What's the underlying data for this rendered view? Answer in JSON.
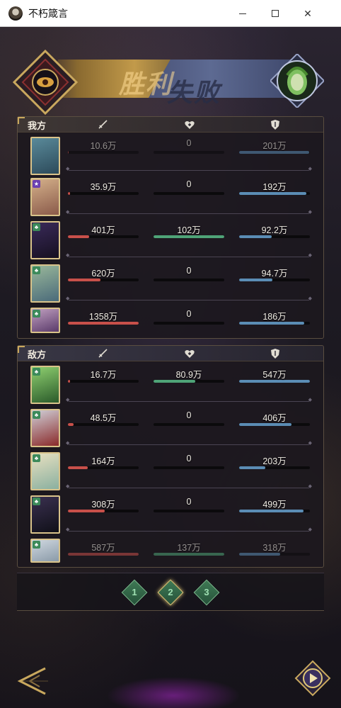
{
  "window": {
    "title": "不朽箴言"
  },
  "banner": {
    "win_text": "胜利",
    "lose_text": "失败"
  },
  "colors": {
    "attack": "#c8504a",
    "heal": "#4fa478",
    "defense": "#5b8db5",
    "gold": "#c9a85e"
  },
  "my_team": {
    "label": "我方",
    "rows": [
      {
        "attack": "10.6万",
        "heal": "0",
        "defense": "201万",
        "attack_pct": 0.01,
        "heal_pct": 0,
        "defense_pct": 0.99,
        "faded": true
      },
      {
        "attack": "35.9万",
        "heal": "0",
        "defense": "192万",
        "attack_pct": 0.03,
        "heal_pct": 0,
        "defense_pct": 0.95
      },
      {
        "attack": "401万",
        "heal": "102万",
        "defense": "92.2万",
        "attack_pct": 0.3,
        "heal_pct": 1.0,
        "defense_pct": 0.46
      },
      {
        "attack": "620万",
        "heal": "0",
        "defense": "94.7万",
        "attack_pct": 0.46,
        "heal_pct": 0,
        "defense_pct": 0.47
      },
      {
        "attack": "1358万",
        "heal": "0",
        "defense": "186万",
        "attack_pct": 1.0,
        "heal_pct": 0,
        "defense_pct": 0.92
      }
    ]
  },
  "enemy_team": {
    "label": "敌方",
    "rows": [
      {
        "attack": "16.7万",
        "heal": "80.9万",
        "defense": "547万",
        "attack_pct": 0.03,
        "heal_pct": 0.59,
        "defense_pct": 1.0
      },
      {
        "attack": "48.5万",
        "heal": "0",
        "defense": "406万",
        "attack_pct": 0.08,
        "heal_pct": 0,
        "defense_pct": 0.74
      },
      {
        "attack": "164万",
        "heal": "0",
        "defense": "203万",
        "attack_pct": 0.28,
        "heal_pct": 0,
        "defense_pct": 0.37
      },
      {
        "attack": "308万",
        "heal": "0",
        "defense": "499万",
        "attack_pct": 0.52,
        "heal_pct": 0,
        "defense_pct": 0.91
      },
      {
        "attack": "587万",
        "heal": "137万",
        "defense": "318万",
        "attack_pct": 1.0,
        "heal_pct": 1.0,
        "defense_pct": 0.58,
        "faded": true
      }
    ]
  },
  "pager": {
    "pages": [
      "1",
      "2",
      "3"
    ],
    "active": 1
  }
}
